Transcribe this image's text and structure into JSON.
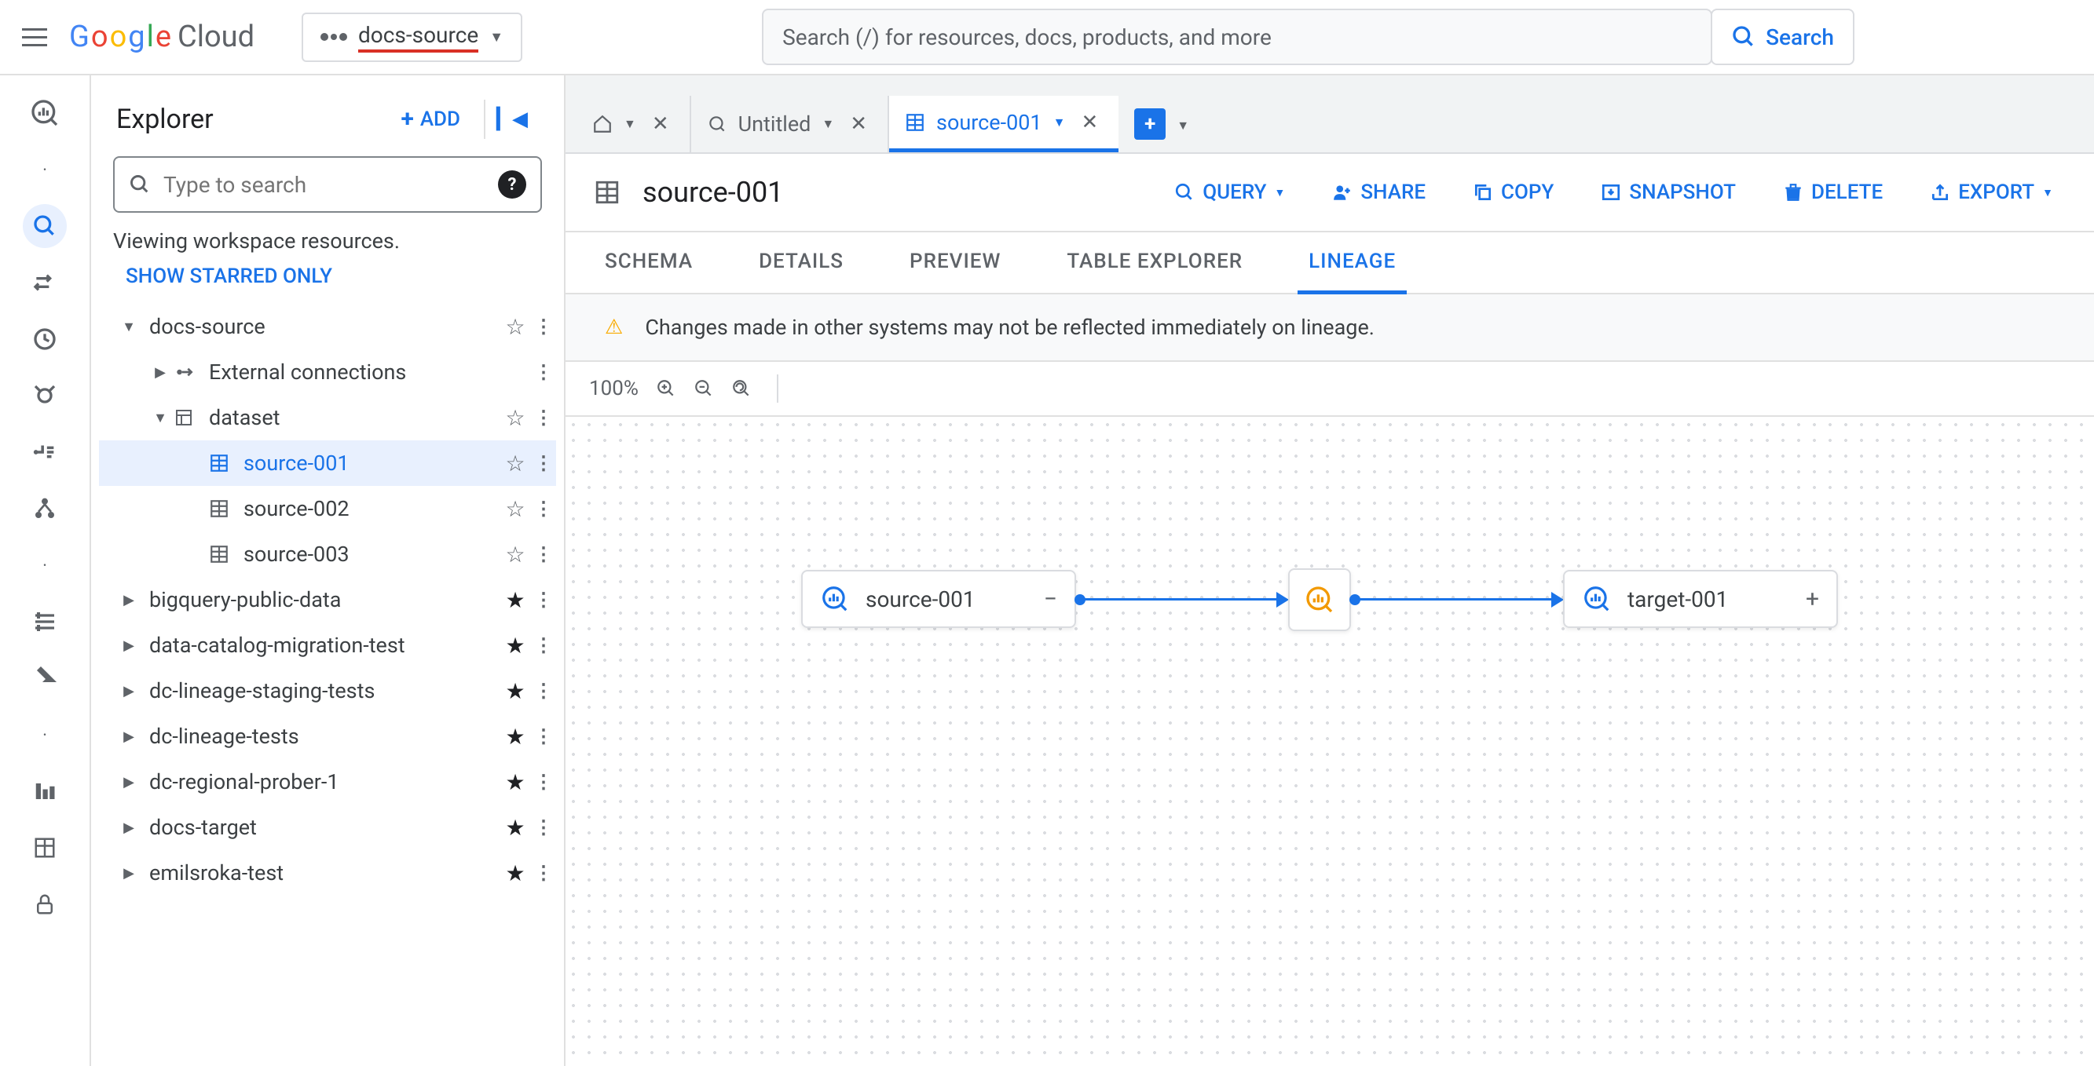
{
  "header": {
    "brand_prefix": "G",
    "brand_o1": "o",
    "brand_o2": "o",
    "brand_g": "g",
    "brand_l": "l",
    "brand_e": "e",
    "brand_cloud": "Cloud",
    "project": "docs-source",
    "search_placeholder": "Search (/) for resources, docs, products, and more",
    "search_button": "Search"
  },
  "explorer": {
    "title": "Explorer",
    "add": "ADD",
    "search_placeholder": "Type to search",
    "viewing": "Viewing workspace resources.",
    "show_starred": "SHOW STARRED ONLY",
    "tree": {
      "project": "docs-source",
      "external": "External connections",
      "dataset": "dataset",
      "tables": [
        "source-001",
        "source-002",
        "source-003"
      ],
      "others": [
        "bigquery-public-data",
        "data-catalog-migration-test",
        "dc-lineage-staging-tests",
        "dc-lineage-tests",
        "dc-regional-prober-1",
        "docs-target",
        "emilsroka-test"
      ]
    }
  },
  "tabs": {
    "untitled": "Untitled",
    "active": "source-001"
  },
  "table": {
    "name": "source-001",
    "actions": {
      "query": "QUERY",
      "share": "SHARE",
      "copy": "COPY",
      "snapshot": "SNAPSHOT",
      "delete": "DELETE",
      "export": "EXPORT"
    },
    "subtabs": [
      "SCHEMA",
      "DETAILS",
      "PREVIEW",
      "TABLE EXPLORER",
      "LINEAGE"
    ],
    "active_subtab": 4,
    "warning": "Changes made in other systems may not be reflected immediately on lineage.",
    "zoom": "100%"
  },
  "lineage": {
    "source": "source-001",
    "target": "target-001"
  }
}
